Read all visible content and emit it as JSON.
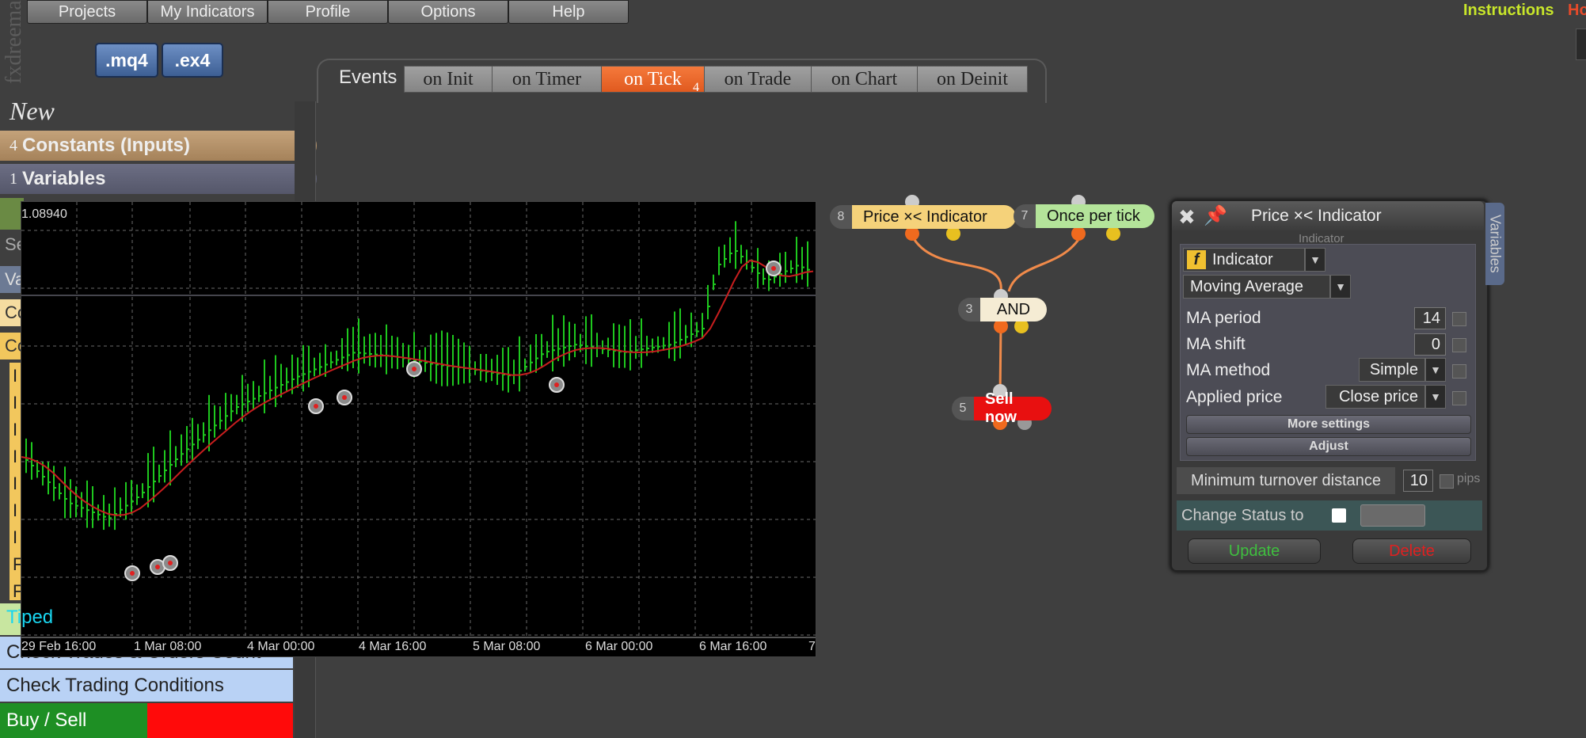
{
  "menu": {
    "items": [
      "Projects",
      "My Indicators",
      "Profile",
      "Options",
      "Help"
    ]
  },
  "top_links": {
    "instructions": "Instructions",
    "partial": "Ho"
  },
  "brand_text": "fxdreema",
  "file_buttons": {
    "mq4": ".mq4",
    "ex4": ".ex4"
  },
  "events": {
    "label": "Events",
    "tabs": [
      "on Init",
      "on Timer",
      "on Tick",
      "on Trade",
      "on Chart",
      "on Deinit"
    ],
    "active_index": 2,
    "active_count": "4"
  },
  "sidebar": {
    "new_label": "New",
    "constants": {
      "count": "4",
      "label": "Constants (Inputs)"
    },
    "variables": {
      "count": "1",
      "label": "Variables"
    },
    "strip_labels": [
      "Se",
      "Va",
      "Co",
      "Co"
    ],
    "column_letters": [
      "I",
      "I",
      "I",
      "I",
      "I",
      "I",
      "I",
      "F",
      "F"
    ],
    "typed_label": "Tiped",
    "lower_items": [
      "Check Trades & Orders Count",
      "Check Trading Conditions"
    ],
    "buy_sell_label": "Buy / Sell"
  },
  "chart": {
    "price_label": "1.08940",
    "x_labels": [
      "29 Feb 16:00",
      "1 Mar 08:00",
      "4 Mar 00:00",
      "4 Mar 16:00",
      "5 Mar 08:00",
      "6 Mar 00:00",
      "6 Mar 16:00",
      "7"
    ]
  },
  "nodes": {
    "price_indicator": {
      "num": "8",
      "label": "Price ×< Indicator"
    },
    "once_per_tick": {
      "num": "7",
      "label": "Once per tick"
    },
    "and": {
      "num": "3",
      "label": "AND"
    },
    "sell_now": {
      "num": "5",
      "label": "Sell now"
    }
  },
  "properties": {
    "title": "Price ×< Indicator",
    "section_caption": "Indicator",
    "type_value": "Indicator",
    "indicator_value": "Moving Average",
    "ma_period_label": "MA period",
    "ma_period_value": "14",
    "ma_shift_label": "MA shift",
    "ma_shift_value": "0",
    "ma_method_label": "MA method",
    "ma_method_value": "Simple",
    "applied_price_label": "Applied price",
    "applied_price_value": "Close price",
    "more_settings": "More settings",
    "adjust": "Adjust",
    "min_turnover_label": "Minimum turnover distance",
    "min_turnover_value": "10",
    "min_turnover_unit": "pips",
    "change_status_label": "Change Status to",
    "update_label": "Update",
    "delete_label": "Delete",
    "variables_tab": "Variables",
    "colors": {
      "update": "#3fbf3f",
      "delete": "#e02020"
    }
  }
}
